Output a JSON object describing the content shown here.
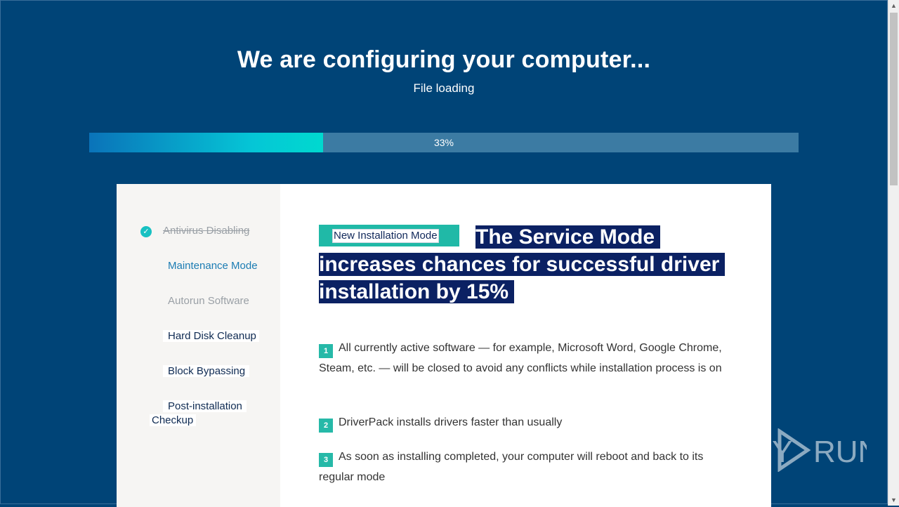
{
  "header": {
    "title": "We are configuring your computer...",
    "subtitle": "File loading"
  },
  "progress": {
    "percent_label": "33%",
    "value": 0.33
  },
  "steps": [
    {
      "label": "Antivirus Disabling",
      "state": "done"
    },
    {
      "label": "Maintenance Mode",
      "state": "active"
    },
    {
      "label": "Autorun Software",
      "state": "muted"
    },
    {
      "label": "Hard Disk Cleanup",
      "state": "pending"
    },
    {
      "label": "Block Bypassing",
      "state": "pending"
    },
    {
      "label": "Post-installation",
      "state": "pending"
    },
    {
      "label": "Checkup",
      "state": "pending"
    }
  ],
  "content": {
    "badge": "New Installation Mode",
    "headline_line1": "The Service Mode",
    "headline_line2": "increases chances for successful driver",
    "headline_line3": "installation by 15%",
    "items": [
      {
        "number": "1",
        "text": "All currently active software — for example, Microsoft Word, Google Chrome, Steam, etc. — will be closed to avoid any conflicts while installation process is on"
      },
      {
        "number": "2",
        "text": "DriverPack installs drivers faster than usually"
      },
      {
        "number": "3",
        "text": "As soon as installing completed, your computer will reboot and back to its regular mode"
      }
    ]
  },
  "watermark": {
    "text": "ANY RUN"
  },
  "colors": {
    "background": "#004477",
    "accent_teal": "#20b9a7",
    "headline_highlight": "#0b2163",
    "active_step": "#1b7cb3"
  },
  "icons": {
    "check": "check-circle-icon",
    "scroll_up": "chevron-up-icon",
    "scroll_down": "chevron-down-icon"
  }
}
